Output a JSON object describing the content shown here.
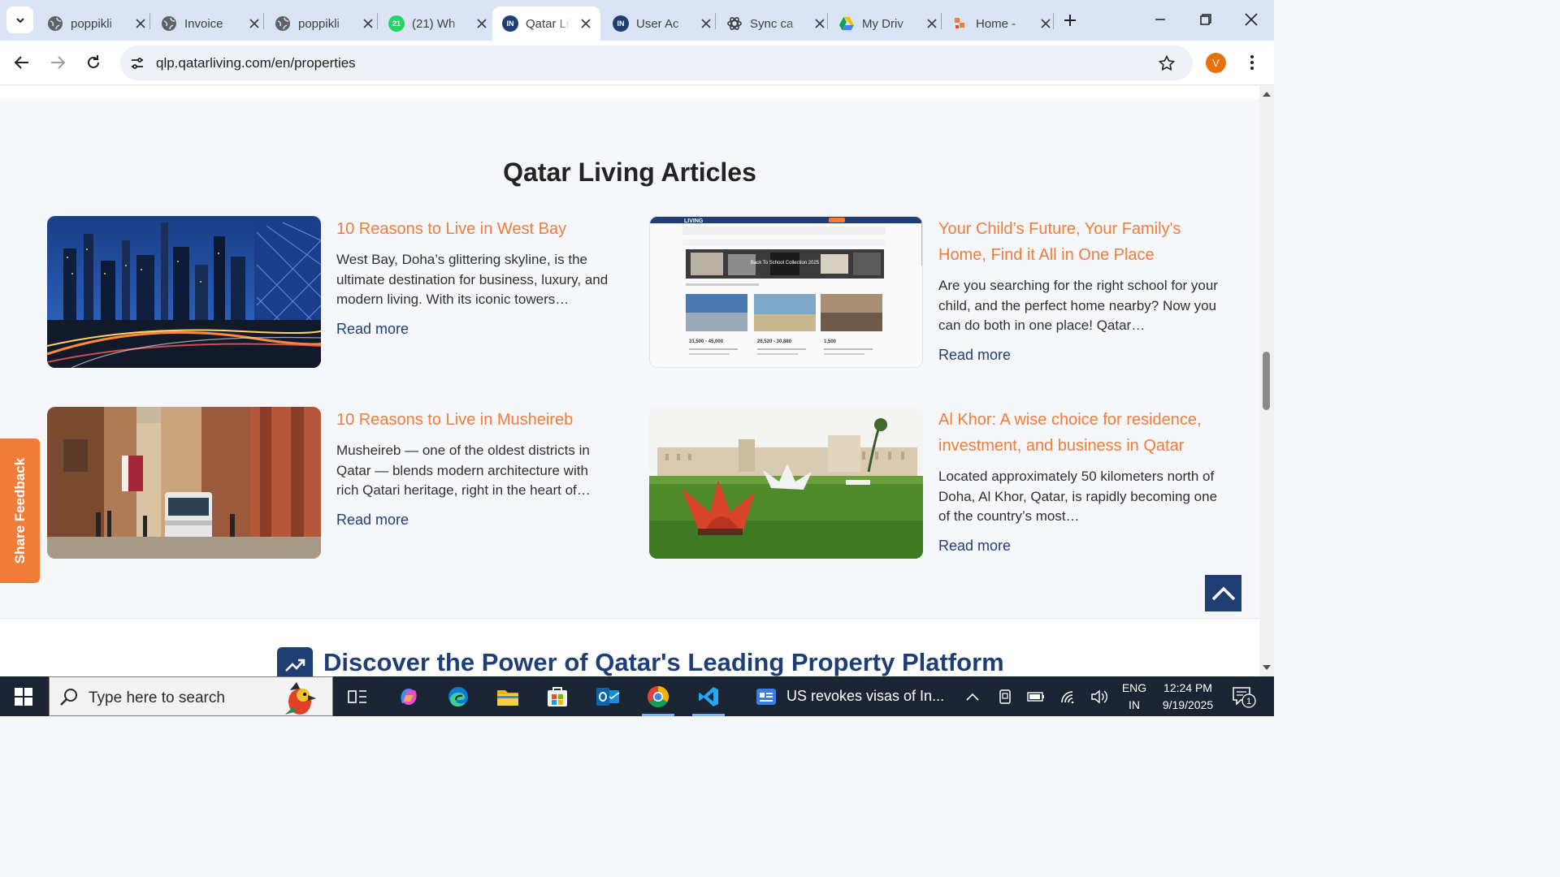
{
  "browser": {
    "tabs": [
      {
        "title": "poppikli",
        "favicon": "globe-icon"
      },
      {
        "title": "Invoice",
        "favicon": "globe-icon"
      },
      {
        "title": "poppikli",
        "favicon": "globe-icon"
      },
      {
        "title": "(21) Wh",
        "favicon": "whatsapp-icon",
        "badge": "21"
      },
      {
        "title": "Qatar Li",
        "favicon": "qatar-living-icon",
        "active": true
      },
      {
        "title": "User Ac",
        "favicon": "qatar-living-icon"
      },
      {
        "title": "Sync ca",
        "favicon": "openai-icon"
      },
      {
        "title": "My Driv",
        "favicon": "google-drive-icon"
      },
      {
        "title": "Home -",
        "favicon": "site-icon"
      }
    ],
    "url": "qlp.qatarliving.com/en/properties",
    "profile_initial": "V",
    "accent": "#e8710a"
  },
  "page": {
    "section_title": "Qatar Living Articles",
    "read_more_label": "Read more",
    "articles": [
      {
        "title": "10 Reasons to Live in West Bay",
        "excerpt": "West Bay, Doha’s glittering skyline, is the ultimate destination for business, luxury, and modern living. With its iconic towers…",
        "image": "west-bay-skyline-night"
      },
      {
        "title": "Your Child’s Future, Your Family's Home, Find it All in One Place",
        "excerpt": "Are you searching for the right school for your child, and the perfect home nearby? Now you can do both in one place!  Qatar…",
        "image": "schools-listing-screenshot",
        "image_text": {
          "logo": "LIVING",
          "banner": "Back To School Collection 2025",
          "prices": [
            "31,500 - 45,000",
            "26,520 - 30,880",
            "1,500"
          ]
        }
      },
      {
        "title": "10 Reasons to Live in Musheireb",
        "excerpt": "Musheireb — one of the oldest districts in Qatar — blends modern architecture with rich Qatari heritage, right in the heart of…",
        "image": "musheireb-tram-street"
      },
      {
        "title": "Al Khor: A wise choice for residence, investment, and business in Qatar",
        "excerpt": "Located approximately 50 kilometers north of Doha, Al Khor, Qatar, is rapidly becoming one of the country’s most…",
        "image": "al-khor-park-sculpture"
      }
    ],
    "feedback_label": "Share Feedback",
    "promo_title": "Discover the Power of Qatar's Leading Property Platform",
    "colors": {
      "accent_orange": "#f27c3a",
      "navy": "#1f3f74"
    }
  },
  "taskbar": {
    "search_placeholder": "Type here to search",
    "news_text": "US revokes visas of In...",
    "language": "ENG",
    "region": "IN",
    "time": "12:24 PM",
    "date": "9/19/2025",
    "notification_count": "1",
    "pinned_apps": [
      "task-view",
      "copilot",
      "edge",
      "file-explorer",
      "microsoft-store",
      "outlook",
      "chrome",
      "vscode"
    ]
  }
}
